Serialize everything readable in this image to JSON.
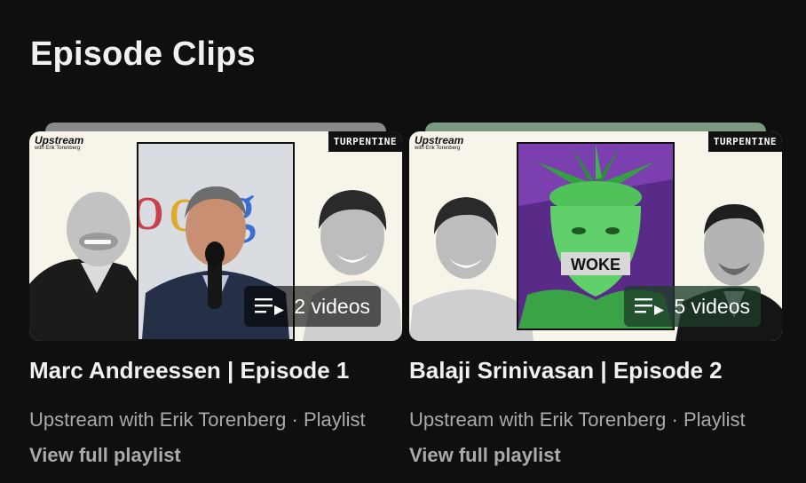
{
  "section": {
    "title": "Episode Clips"
  },
  "cards": [
    {
      "title": "Marc Andreessen | Episode 1",
      "channel": "Upstream with Erik Torenberg",
      "separator": "·",
      "type": "Playlist",
      "video_count": "2 videos",
      "view_link": "View full playlist",
      "thumb": {
        "brand": "Upstream",
        "brand_sub": "with Erik Torenberg",
        "label": "TURPENTINE",
        "tab_color": "#8a8a8a"
      }
    },
    {
      "title": "Balaji Srinivasan | Episode 2",
      "channel": "Upstream with Erik Torenberg",
      "separator": "·",
      "type": "Playlist",
      "video_count": "5 videos",
      "view_link": "View full playlist",
      "thumb": {
        "brand": "Upstream",
        "brand_sub": "with Erik Torenberg",
        "label": "TURPENTINE",
        "sign_text": "WOKE",
        "tab_color": "#7c9a7f"
      }
    }
  ],
  "colors": {
    "background": "#0f0f0f",
    "title_text": "#f1f1f1",
    "meta_text": "#aaaaaa"
  }
}
